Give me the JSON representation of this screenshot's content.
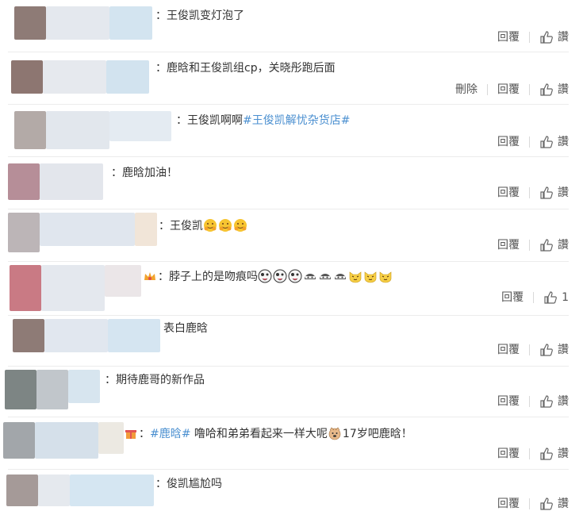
{
  "comments": [
    {
      "text": "：王俊凯变灯泡了",
      "reply": "回覆",
      "like": "讚"
    },
    {
      "text": "：鹿晗和王俊凯组cp，关晓彤跑后面",
      "delete": "刪除",
      "reply": "回覆",
      "like": "讚"
    },
    {
      "text_pre": "：王俊凯啊啊",
      "hashtag": "#王俊凯解忧杂货店#",
      "reply": "回覆",
      "like": "讚"
    },
    {
      "text": "：鹿晗加油！",
      "reply": "回覆",
      "like": "讚"
    },
    {
      "text": "：王俊凯",
      "emoji": [
        "hug-emoji",
        "hug-emoji",
        "hug-emoji"
      ],
      "reply": "回覆",
      "like": "讚"
    },
    {
      "text": "：脖子上的是吻痕吗",
      "emoji": [
        "silly-emoji",
        "silly-emoji",
        "silly-emoji",
        "mask-emoji",
        "mask-emoji",
        "mask-emoji",
        "cat-emoji",
        "cat-emoji",
        "cat-emoji"
      ],
      "reply": "回覆",
      "like_count": "1"
    },
    {
      "text": "表白鹿晗",
      "reply": "回覆",
      "like": "讚"
    },
    {
      "text": "：期待鹿哥的新作品",
      "reply": "回覆",
      "like": "讚"
    },
    {
      "text_pre": "：",
      "hashtag": "#鹿晗#",
      "text_mid": " 噜哈和弟弟看起来一样大呢",
      "text_post": "17岁吧鹿晗！",
      "reply": "回覆",
      "like": "讚"
    },
    {
      "text": "：俊凯尴尬吗",
      "reply": "回覆",
      "like": "讚"
    }
  ],
  "colors": {
    "hashtag": "#4a8fd0",
    "text": "#333333",
    "action": "#555555",
    "divider": "#ececec"
  }
}
